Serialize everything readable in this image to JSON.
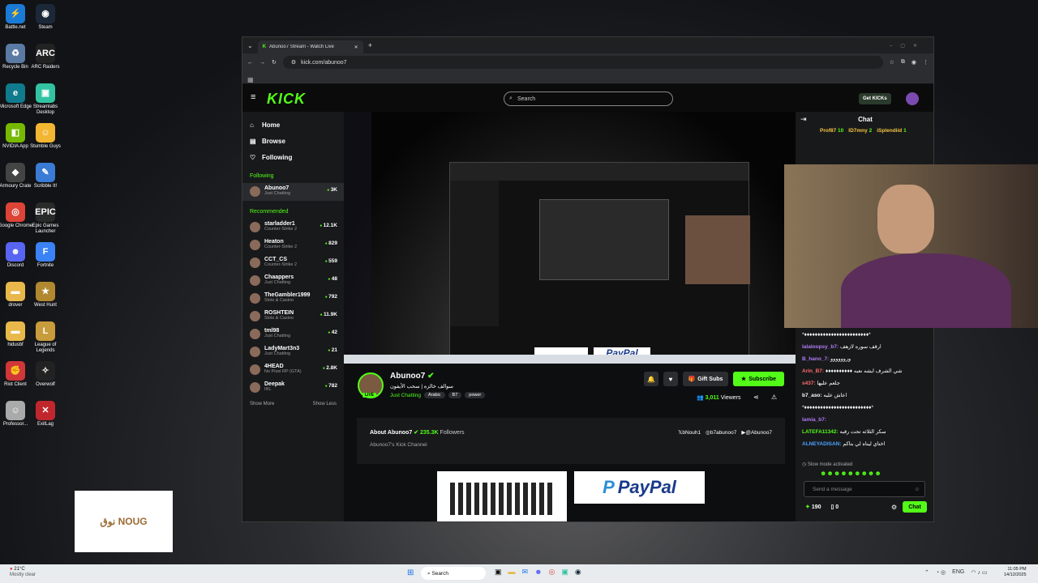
{
  "desktop": {
    "icons": [
      {
        "label": "Battle.net",
        "icon": "battlenet-icon",
        "color": "#1a7ad6",
        "glyph": "⚡"
      },
      {
        "label": "Steam",
        "icon": "steam-icon",
        "color": "#1b2838",
        "glyph": "◉"
      },
      {
        "label": "Recycle Bin",
        "icon": "recycle-bin-icon",
        "color": "#5b7aa3",
        "glyph": "♻"
      },
      {
        "label": "ARC Raiders",
        "icon": "arc-raiders-icon",
        "color": "#222",
        "glyph": "ARC"
      },
      {
        "label": "Microsoft Edge",
        "icon": "edge-icon",
        "color": "#0f7b8c",
        "glyph": "e"
      },
      {
        "label": "Streamlabs Desktop",
        "icon": "streamlabs-icon",
        "color": "#31c3a2",
        "glyph": "▣"
      },
      {
        "label": "NVIDIA App",
        "icon": "nvidia-icon",
        "color": "#76b900",
        "glyph": "◧"
      },
      {
        "label": "Stumble Guys",
        "icon": "stumble-guys-icon",
        "color": "#f2b632",
        "glyph": "☺"
      },
      {
        "label": "Armoury Crate",
        "icon": "armoury-crate-icon",
        "color": "#444",
        "glyph": "◆"
      },
      {
        "label": "Scribble It!",
        "icon": "scribble-it-icon",
        "color": "#3a7bd5",
        "glyph": "✎"
      },
      {
        "label": "Google Chrome",
        "icon": "chrome-icon",
        "color": "#db4437",
        "glyph": "◎"
      },
      {
        "label": "Epic Games Launcher",
        "icon": "epic-games-icon",
        "color": "#2a2a2a",
        "glyph": "EPIC"
      },
      {
        "label": "Discord",
        "icon": "discord-icon",
        "color": "#5865f2",
        "glyph": "☻"
      },
      {
        "label": "Fortnite",
        "icon": "fortnite-icon",
        "color": "#3b82f6",
        "glyph": "F"
      },
      {
        "label": "drover",
        "icon": "folder-icon",
        "color": "#e8b84a",
        "glyph": "▬"
      },
      {
        "label": "West Hunt",
        "icon": "west-hunt-icon",
        "color": "#b08830",
        "glyph": "★"
      },
      {
        "label": "hidusbf",
        "icon": "folder-icon",
        "color": "#e8b84a",
        "glyph": "▬"
      },
      {
        "label": "League of Legends",
        "icon": "league-icon",
        "color": "#c89b3c",
        "glyph": "L"
      },
      {
        "label": "Riot Client",
        "icon": "riot-client-icon",
        "color": "#d13639",
        "glyph": "✊"
      },
      {
        "label": "Overwolf",
        "icon": "overwolf-icon",
        "color": "#222",
        "glyph": "✧"
      },
      {
        "label": "Professor...",
        "icon": "professor-icon",
        "color": "#aaa",
        "glyph": "☺"
      },
      {
        "label": "ExitLag",
        "icon": "exitlag-icon",
        "color": "#c0272d",
        "glyph": "✕"
      }
    ],
    "ad_text": "نوق NOUG"
  },
  "browser": {
    "tab_title": "Abunoo7 Stream - Watch Live",
    "url": "kick.com/abunoo7"
  },
  "kick": {
    "logo": "KICK",
    "search_placeholder": "Search",
    "get_kicks": "Get KICKs",
    "nav": [
      {
        "label": "Home",
        "icon": "home-icon",
        "glyph": "⌂"
      },
      {
        "label": "Browse",
        "icon": "browse-icon",
        "glyph": "▤"
      },
      {
        "label": "Following",
        "icon": "heart-icon",
        "glyph": "♡"
      }
    ],
    "following_header": "Following",
    "following": [
      {
        "name": "Abunoo7",
        "category": "Just Chatting",
        "viewers": "3K"
      }
    ],
    "recommended_header": "Recommended",
    "recommended": [
      {
        "name": "starladder1",
        "category": "Counter-Strike 2",
        "viewers": "12.1K"
      },
      {
        "name": "Heaton",
        "category": "Counter-Strike 2",
        "viewers": "829"
      },
      {
        "name": "CCT_CS",
        "category": "Counter-Strike 2",
        "viewers": "559"
      },
      {
        "name": "Chaappers",
        "category": "Just Chatting",
        "viewers": "48"
      },
      {
        "name": "TheGambler1999",
        "category": "Slots & Casino",
        "viewers": "792"
      },
      {
        "name": "ROSHTEIN",
        "category": "Slots & Casino",
        "viewers": "11.9K"
      },
      {
        "name": "tml98",
        "category": "Just Chatting",
        "viewers": "42"
      },
      {
        "name": "LadyMart3n3",
        "category": "Just Chatting",
        "viewers": "21"
      },
      {
        "name": "4HEAD",
        "category": "No Pixel RP (GTA)",
        "viewers": "2.8K"
      },
      {
        "name": "Deepak",
        "category": "IRL",
        "viewers": "782"
      }
    ],
    "show_more": "Show More",
    "show_less": "Show Less",
    "streamer": {
      "name": "Abunoo7",
      "title": "سوالف خالزه | سحب الأيفون",
      "category": "Just Chatting",
      "tags": [
        "Arabic",
        "B7",
        "power"
      ],
      "live": "LIVE",
      "viewers": "3,011",
      "viewers_label": "Viewers",
      "gift_subs": "Gift Subs",
      "subscribe": "Subscribe"
    },
    "about": {
      "title": "About Abunoo7",
      "followers": "235.3K",
      "followers_label": "Followers",
      "description": "Abunoo7's Kick Channel",
      "socials": [
        {
          "label": "bNouh1",
          "icon": "x-icon",
          "glyph": "𝕏"
        },
        {
          "label": "b7abunoo7",
          "icon": "instagram-icon",
          "glyph": "◎"
        },
        {
          "label": "@Abunoo7",
          "icon": "youtube-icon",
          "glyph": "▶"
        }
      ]
    },
    "paypal": "PayPal",
    "chat": {
      "title": "Chat",
      "gifters": [
        {
          "name": "Prof87",
          "count": "10"
        },
        {
          "name": "ID7mny",
          "count": "2"
        },
        {
          "name": "iSplendiid",
          "count": "1"
        }
      ],
      "messages": [
        {
          "user": "",
          "text": "*♦♦♦♦♦♦♦♦♦♦♦♦♦♦♦♦♦♦♦♦♦♦♦♦*",
          "color": "#fff"
        },
        {
          "user": "lalaloopsy_b7:",
          "text": "ارقف سوره لازهف",
          "color": "#b07cf5"
        },
        {
          "user": "B_hano_7:",
          "text": "وروووووو",
          "color": "#b07cf5"
        },
        {
          "user": "Arin_B7:",
          "text": "♦♦♦♦♦♦♦♦♦♦ شي الشرف ايشه نعبه",
          "color": "#ff6b6b"
        },
        {
          "user": "s437:",
          "text": "جلعم عليها",
          "color": "#ff6b6b"
        },
        {
          "user": "b7_aso:",
          "text": "اعاش عليه",
          "color": "#fff"
        },
        {
          "user": "",
          "text": "*♦♦♦♦♦♦♦♦♦♦♦♦♦♦♦♦♦♦♦♦♦♦♦♦♦*",
          "color": "#fff"
        },
        {
          "user": "lamia_b7:",
          "text": "",
          "color": "#b07cf5"
        },
        {
          "user": "LATEFA11342:",
          "text": "سكر الثلاثه تحت رقبه",
          "color": "#53fc18"
        },
        {
          "user": "ALNEYADISAN:",
          "text": "اختاي ليناه لي بتاكم",
          "color": "#4aa3ff"
        }
      ],
      "slow_mode": "Slow mode activated",
      "send_placeholder": "Send a message",
      "points": "190",
      "zero": "0",
      "chat_button": "Chat"
    }
  },
  "taskbar": {
    "temp": "21°C",
    "weather": "Mostly clear",
    "search": "Search",
    "lang": "ENG",
    "time": "11:05 PM",
    "date": "14/12/2025"
  }
}
